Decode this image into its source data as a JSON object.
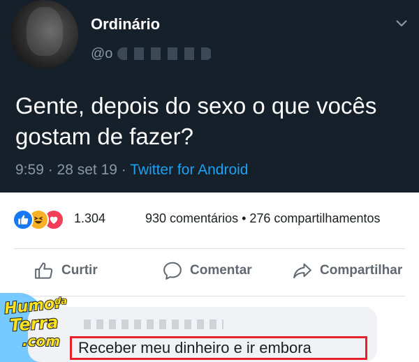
{
  "tweet": {
    "display_name": "Ordinário",
    "handle": "@o",
    "text": "Gente, depois do sexo o que vocês gostam de fazer?",
    "time": "9:59",
    "date": "28 set 19",
    "source": "Twitter for Android",
    "icons": {
      "menu": "chevron-down-icon"
    }
  },
  "reactions": {
    "icons": [
      "like-icon",
      "haha-icon",
      "love-icon"
    ],
    "count": "1.304",
    "stats": "930 comentários • 276 compartilhamentos"
  },
  "actions": {
    "like": "Curtir",
    "comment": "Comentar",
    "share": "Compartilhar"
  },
  "comment": {
    "text": "Receber meu dinheiro e ir embora"
  },
  "watermark": {
    "line1": "Humor",
    "line1_small": "da",
    "line2": "Terra",
    "line3": ".com"
  },
  "colors": {
    "tweet_bg": "#15202b",
    "link": "#1da1f2",
    "highlight_box": "#e8202a",
    "fb_like": "#1877f2"
  }
}
